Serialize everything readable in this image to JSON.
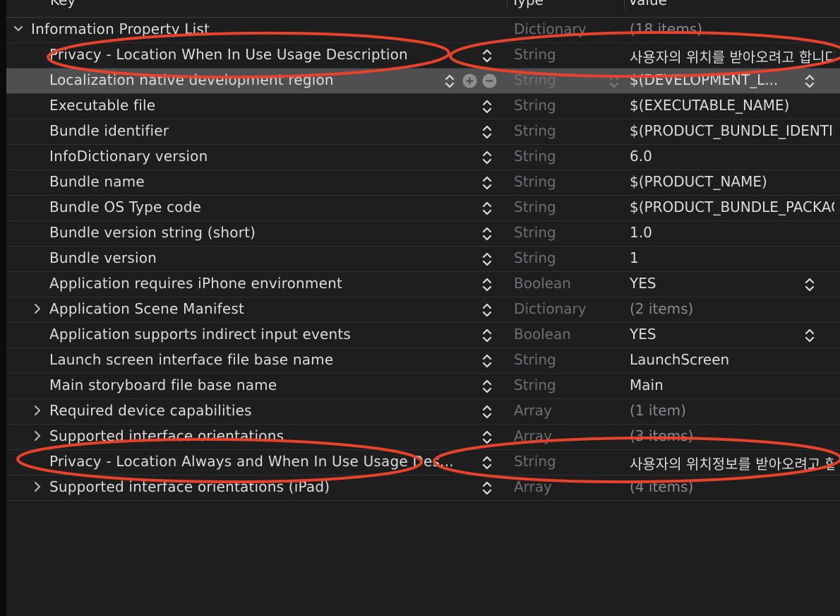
{
  "header": {
    "key": "Key",
    "type": "Type",
    "value": "Value"
  },
  "rows": [
    {
      "key": "Information Property List",
      "type": "Dictionary",
      "value": "(18 items)",
      "indent": 0,
      "disclosure": "down",
      "stepper": false,
      "value_dim": true
    },
    {
      "key": "Privacy - Location When In Use Usage Description",
      "type": "String",
      "value": "사용자의 위치를 받아오려고 합니다",
      "indent": 1,
      "stepper": true
    },
    {
      "key": "Localization native development region",
      "type": "String",
      "value": "$(DEVELOPMENT_L...",
      "indent": 1,
      "stepper": true,
      "selected": true,
      "row_buttons": true,
      "type_stepper": true,
      "value_stepper": true
    },
    {
      "key": "Executable file",
      "type": "String",
      "value": "$(EXECUTABLE_NAME)",
      "indent": 1,
      "stepper": true
    },
    {
      "key": "Bundle identifier",
      "type": "String",
      "value": "$(PRODUCT_BUNDLE_IDENTIFIER)",
      "indent": 1,
      "stepper": true
    },
    {
      "key": "InfoDictionary version",
      "type": "String",
      "value": "6.0",
      "indent": 1,
      "stepper": true
    },
    {
      "key": "Bundle name",
      "type": "String",
      "value": "$(PRODUCT_NAME)",
      "indent": 1,
      "stepper": true
    },
    {
      "key": "Bundle OS Type code",
      "type": "String",
      "value": "$(PRODUCT_BUNDLE_PACKAGE_TYPE)",
      "indent": 1,
      "stepper": true
    },
    {
      "key": "Bundle version string (short)",
      "type": "String",
      "value": "1.0",
      "indent": 1,
      "stepper": true
    },
    {
      "key": "Bundle version",
      "type": "String",
      "value": "1",
      "indent": 1,
      "stepper": true
    },
    {
      "key": "Application requires iPhone environment",
      "type": "Boolean",
      "value": "YES",
      "indent": 1,
      "stepper": true,
      "value_stepper": true
    },
    {
      "key": "Application Scene Manifest",
      "type": "Dictionary",
      "value": "(2 items)",
      "indent": 1,
      "disclosure": "right",
      "stepper": true,
      "value_dim": true
    },
    {
      "key": "Application supports indirect input events",
      "type": "Boolean",
      "value": "YES",
      "indent": 1,
      "stepper": true,
      "value_stepper": true
    },
    {
      "key": "Launch screen interface file base name",
      "type": "String",
      "value": "LaunchScreen",
      "indent": 1,
      "stepper": true
    },
    {
      "key": "Main storyboard file base name",
      "type": "String",
      "value": "Main",
      "indent": 1,
      "stepper": true
    },
    {
      "key": "Required device capabilities",
      "type": "Array",
      "value": "(1 item)",
      "indent": 1,
      "disclosure": "right",
      "stepper": true,
      "value_dim": true
    },
    {
      "key": "Supported interface orientations",
      "type": "Array",
      "value": "(3 items)",
      "indent": 1,
      "disclosure": "right",
      "stepper": true,
      "value_dim": true
    },
    {
      "key": "Privacy - Location Always and When In Use Usage Des...",
      "type": "String",
      "value": "사용자의 위치정보를 받아오려고 합니다",
      "indent": 1,
      "stepper": true
    },
    {
      "key": "Supported interface orientations (iPad)",
      "type": "Array",
      "value": "(4 items)",
      "indent": 1,
      "disclosure": "right",
      "stepper": true,
      "value_dim": true
    }
  ],
  "colors": {
    "annotation": "#e8412c",
    "background": "#1e1e1f",
    "selected_row": "#4f4f52",
    "type_text": "#6f6f72"
  },
  "icons": {
    "disclosure_down": "chevron-down-icon",
    "disclosure_right": "chevron-right-icon",
    "stepper": "up-down-stepper-icon",
    "add": "plus-circle-icon",
    "remove": "minus-circle-icon"
  }
}
